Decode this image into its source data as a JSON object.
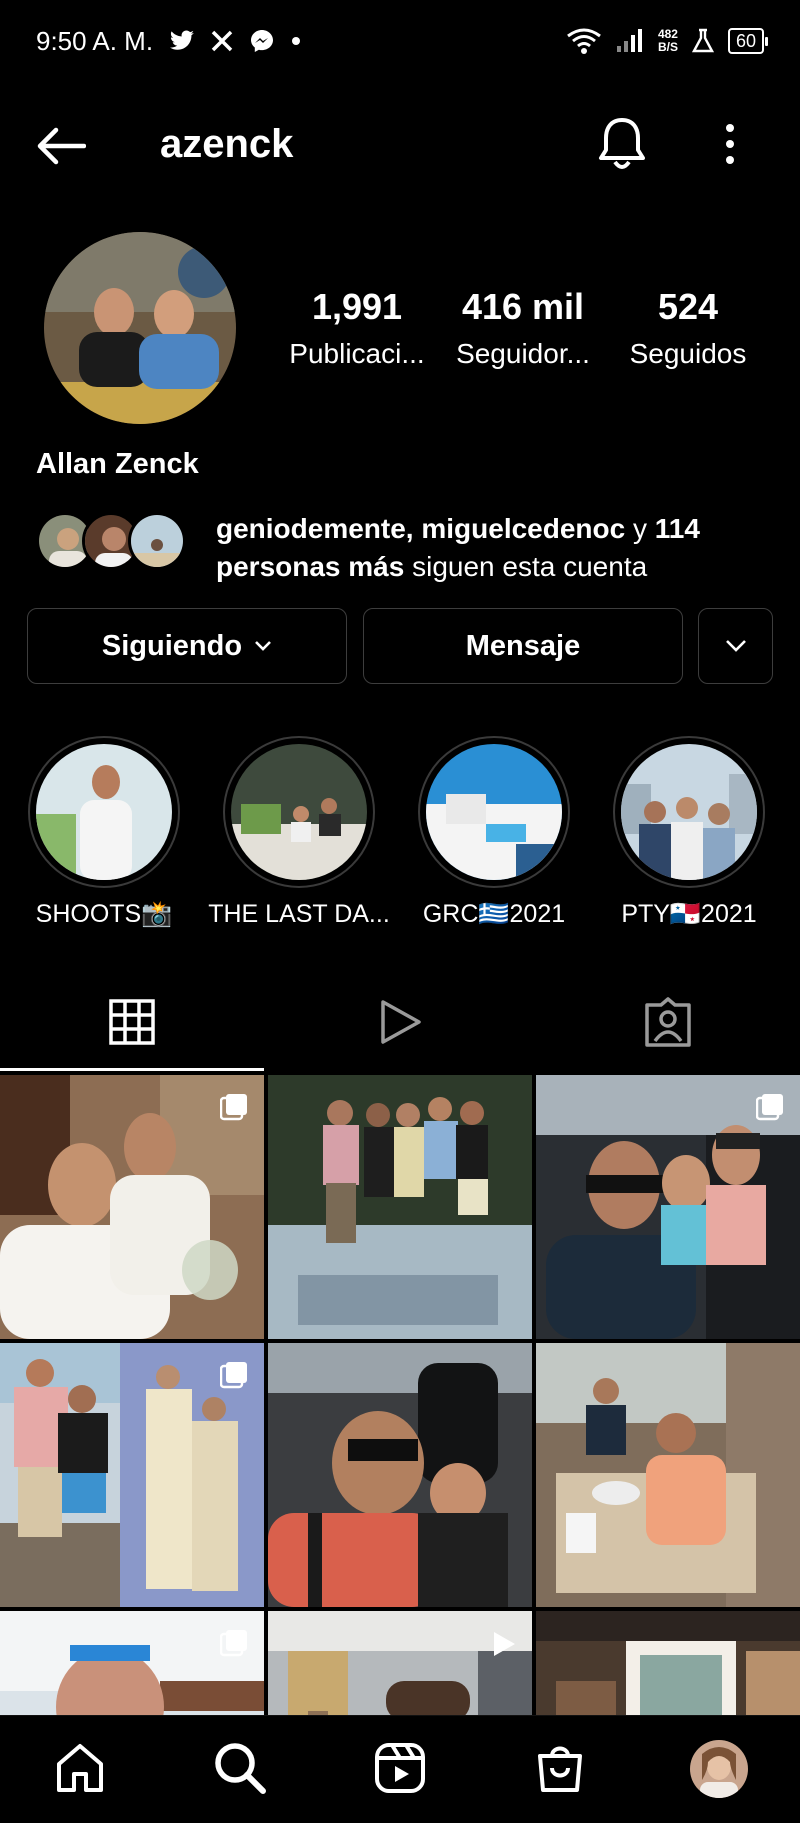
{
  "status_bar": {
    "time": "9:50 A. M.",
    "net_speed_value": "482",
    "net_speed_unit": "B/S",
    "battery": "60"
  },
  "header": {
    "username": "azenck"
  },
  "profile": {
    "full_name": "Allan Zenck",
    "stats": [
      {
        "value": "1,991",
        "label": "Publicaci..."
      },
      {
        "value": "416 mil",
        "label": "Seguidor..."
      },
      {
        "value": "524",
        "label": "Seguidos"
      }
    ],
    "mutual": {
      "names": "geniodemente, miguelcedenoc",
      "conj": " y ",
      "count": "114",
      "line2_bold": "personas más",
      "line2_rest": " siguen esta cuenta"
    }
  },
  "buttons": {
    "following": "Siguiendo",
    "message": "Mensaje"
  },
  "highlights": [
    {
      "label": "SHOOTS📸"
    },
    {
      "label": "THE LAST DA..."
    },
    {
      "label": "GRC🇬🇷2021"
    },
    {
      "label": "PTY🇵🇦2021"
    }
  ],
  "icons": {
    "back": "back-arrow-icon",
    "bell": "bell-icon",
    "more": "more-vertical-icon",
    "grid": "grid-icon",
    "reels": "reels-play-icon",
    "tagged": "tagged-person-icon",
    "home": "home-icon",
    "search": "search-icon",
    "reels_nav": "reels-icon",
    "shop": "shop-bag-icon"
  },
  "colors": {
    "background": "#000000",
    "button_border": "#3d3d3d",
    "text": "#ffffff"
  }
}
